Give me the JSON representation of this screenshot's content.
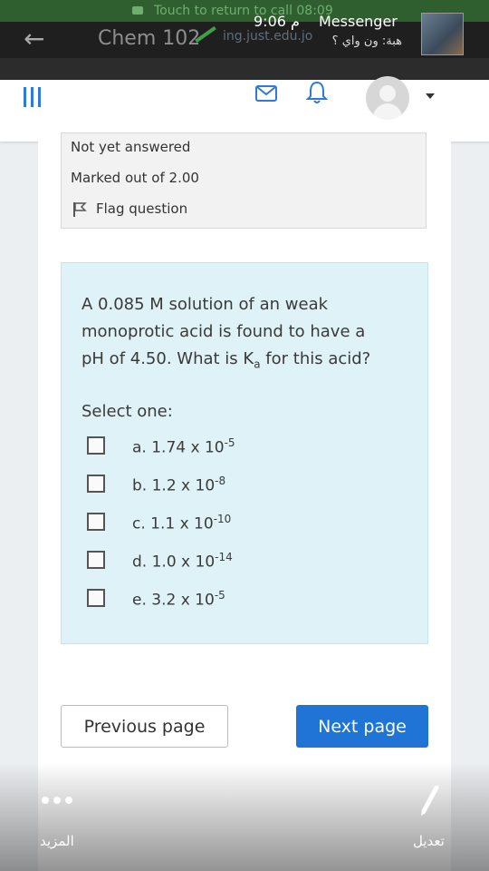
{
  "call_banner": {
    "text": "Touch to return to call 08:09"
  },
  "browser": {
    "title": "Chem 102",
    "url_fragment": "ing.just.edu.jo"
  },
  "notification": {
    "time": "9:06 م",
    "app": "Messenger",
    "sender": "هبة: ون واي ؟"
  },
  "header": {
    "icons": [
      "hamburger-icon",
      "messages-icon",
      "bell-icon",
      "user-avatar",
      "caret-icon"
    ]
  },
  "question_info": {
    "status": "Not yet answered",
    "marked": "Marked out of 2.00",
    "flag": "Flag question"
  },
  "question": {
    "line1": "A 0.085 M solution of an weak",
    "line2": "monoprotic acid is found to have a",
    "line3_pre": "pH of 4.50. What is K",
    "line3_sub": "a",
    "line3_post": " for this acid?",
    "select_label": "Select one:",
    "options": [
      {
        "base": "a. 1.74 x 10",
        "exp": "-5"
      },
      {
        "base": "b. 1.2 x 10",
        "exp": "-8"
      },
      {
        "base": "c. 1.1 x 10",
        "exp": "-10"
      },
      {
        "base": "d. 1.0 x 10",
        "exp": "-14"
      },
      {
        "base": "e. 3.2 x 10",
        "exp": "-5"
      }
    ]
  },
  "nav": {
    "previous": "Previous page",
    "next": "Next page"
  },
  "bottom_bar": {
    "more": "المزيد",
    "edit": "تعديل"
  },
  "colors": {
    "accent": "#1f74d6",
    "question_bg": "#def2f8",
    "info_bg": "#f2f2f2"
  }
}
